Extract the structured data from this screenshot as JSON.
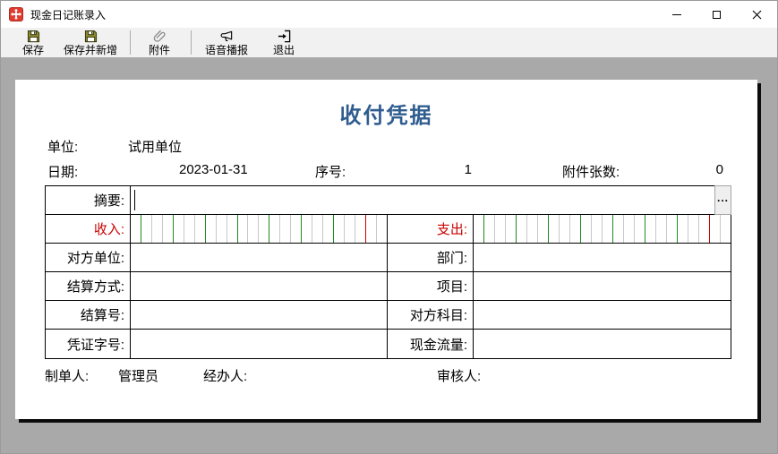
{
  "window": {
    "title": "现金日记账录入"
  },
  "toolbar": {
    "save": "保存",
    "save_new": "保存并新增",
    "attachment": "附件",
    "voice": "语音播报",
    "exit": "退出"
  },
  "form": {
    "title": "收付凭据",
    "unit": {
      "label": "单位:",
      "value": "试用单位"
    },
    "date": {
      "label": "日期:",
      "value": "2023-01-31"
    },
    "serial": {
      "label": "序号:",
      "value": "1"
    },
    "attachments": {
      "label": "附件张数:",
      "value": "0"
    },
    "summary": {
      "label": "摘要:",
      "value": "",
      "more_button": "..."
    },
    "income": {
      "label": "收入:",
      "value": ""
    },
    "expense": {
      "label": "支出:",
      "value": ""
    },
    "detail_rows": [
      {
        "left": "对方单位:",
        "left_value": "",
        "right": "部门:",
        "right_value": ""
      },
      {
        "left": "结算方式:",
        "left_value": "",
        "right": "项目:",
        "right_value": ""
      },
      {
        "left": "结算号:",
        "left_value": "",
        "right": "对方科目:",
        "right_value": ""
      },
      {
        "left": "凭证字号:",
        "left_value": "",
        "right": "现金流量:",
        "right_value": ""
      }
    ],
    "footer": {
      "preparer_label": "制单人:",
      "preparer_value": "管理员",
      "handler_label": "经办人:",
      "handler_value": "",
      "reviewer_label": "审核人:",
      "reviewer_value": ""
    }
  },
  "colors": {
    "form_title_blue": "#2F5C8F",
    "amount_label_red": "#C80000",
    "grid_green": "#1E8A1E",
    "grid_red": "#D00000",
    "grid_gray": "#C8C8C8",
    "app_icon_red": "#E03B2F",
    "paper_shadow": "#0C0C0C",
    "desktop_gray": "#A9A9A9"
  },
  "icons": {
    "app": "app-move-arrows-icon",
    "save": "floppy-disk-icon",
    "save_new": "floppy-disk-icon",
    "attachment": "paperclip-icon",
    "voice": "megaphone-icon",
    "exit": "exit-arrow-icon",
    "minimize": "minimize-icon",
    "maximize": "maximize-icon",
    "close": "close-icon",
    "more": "ellipsis-icon"
  }
}
